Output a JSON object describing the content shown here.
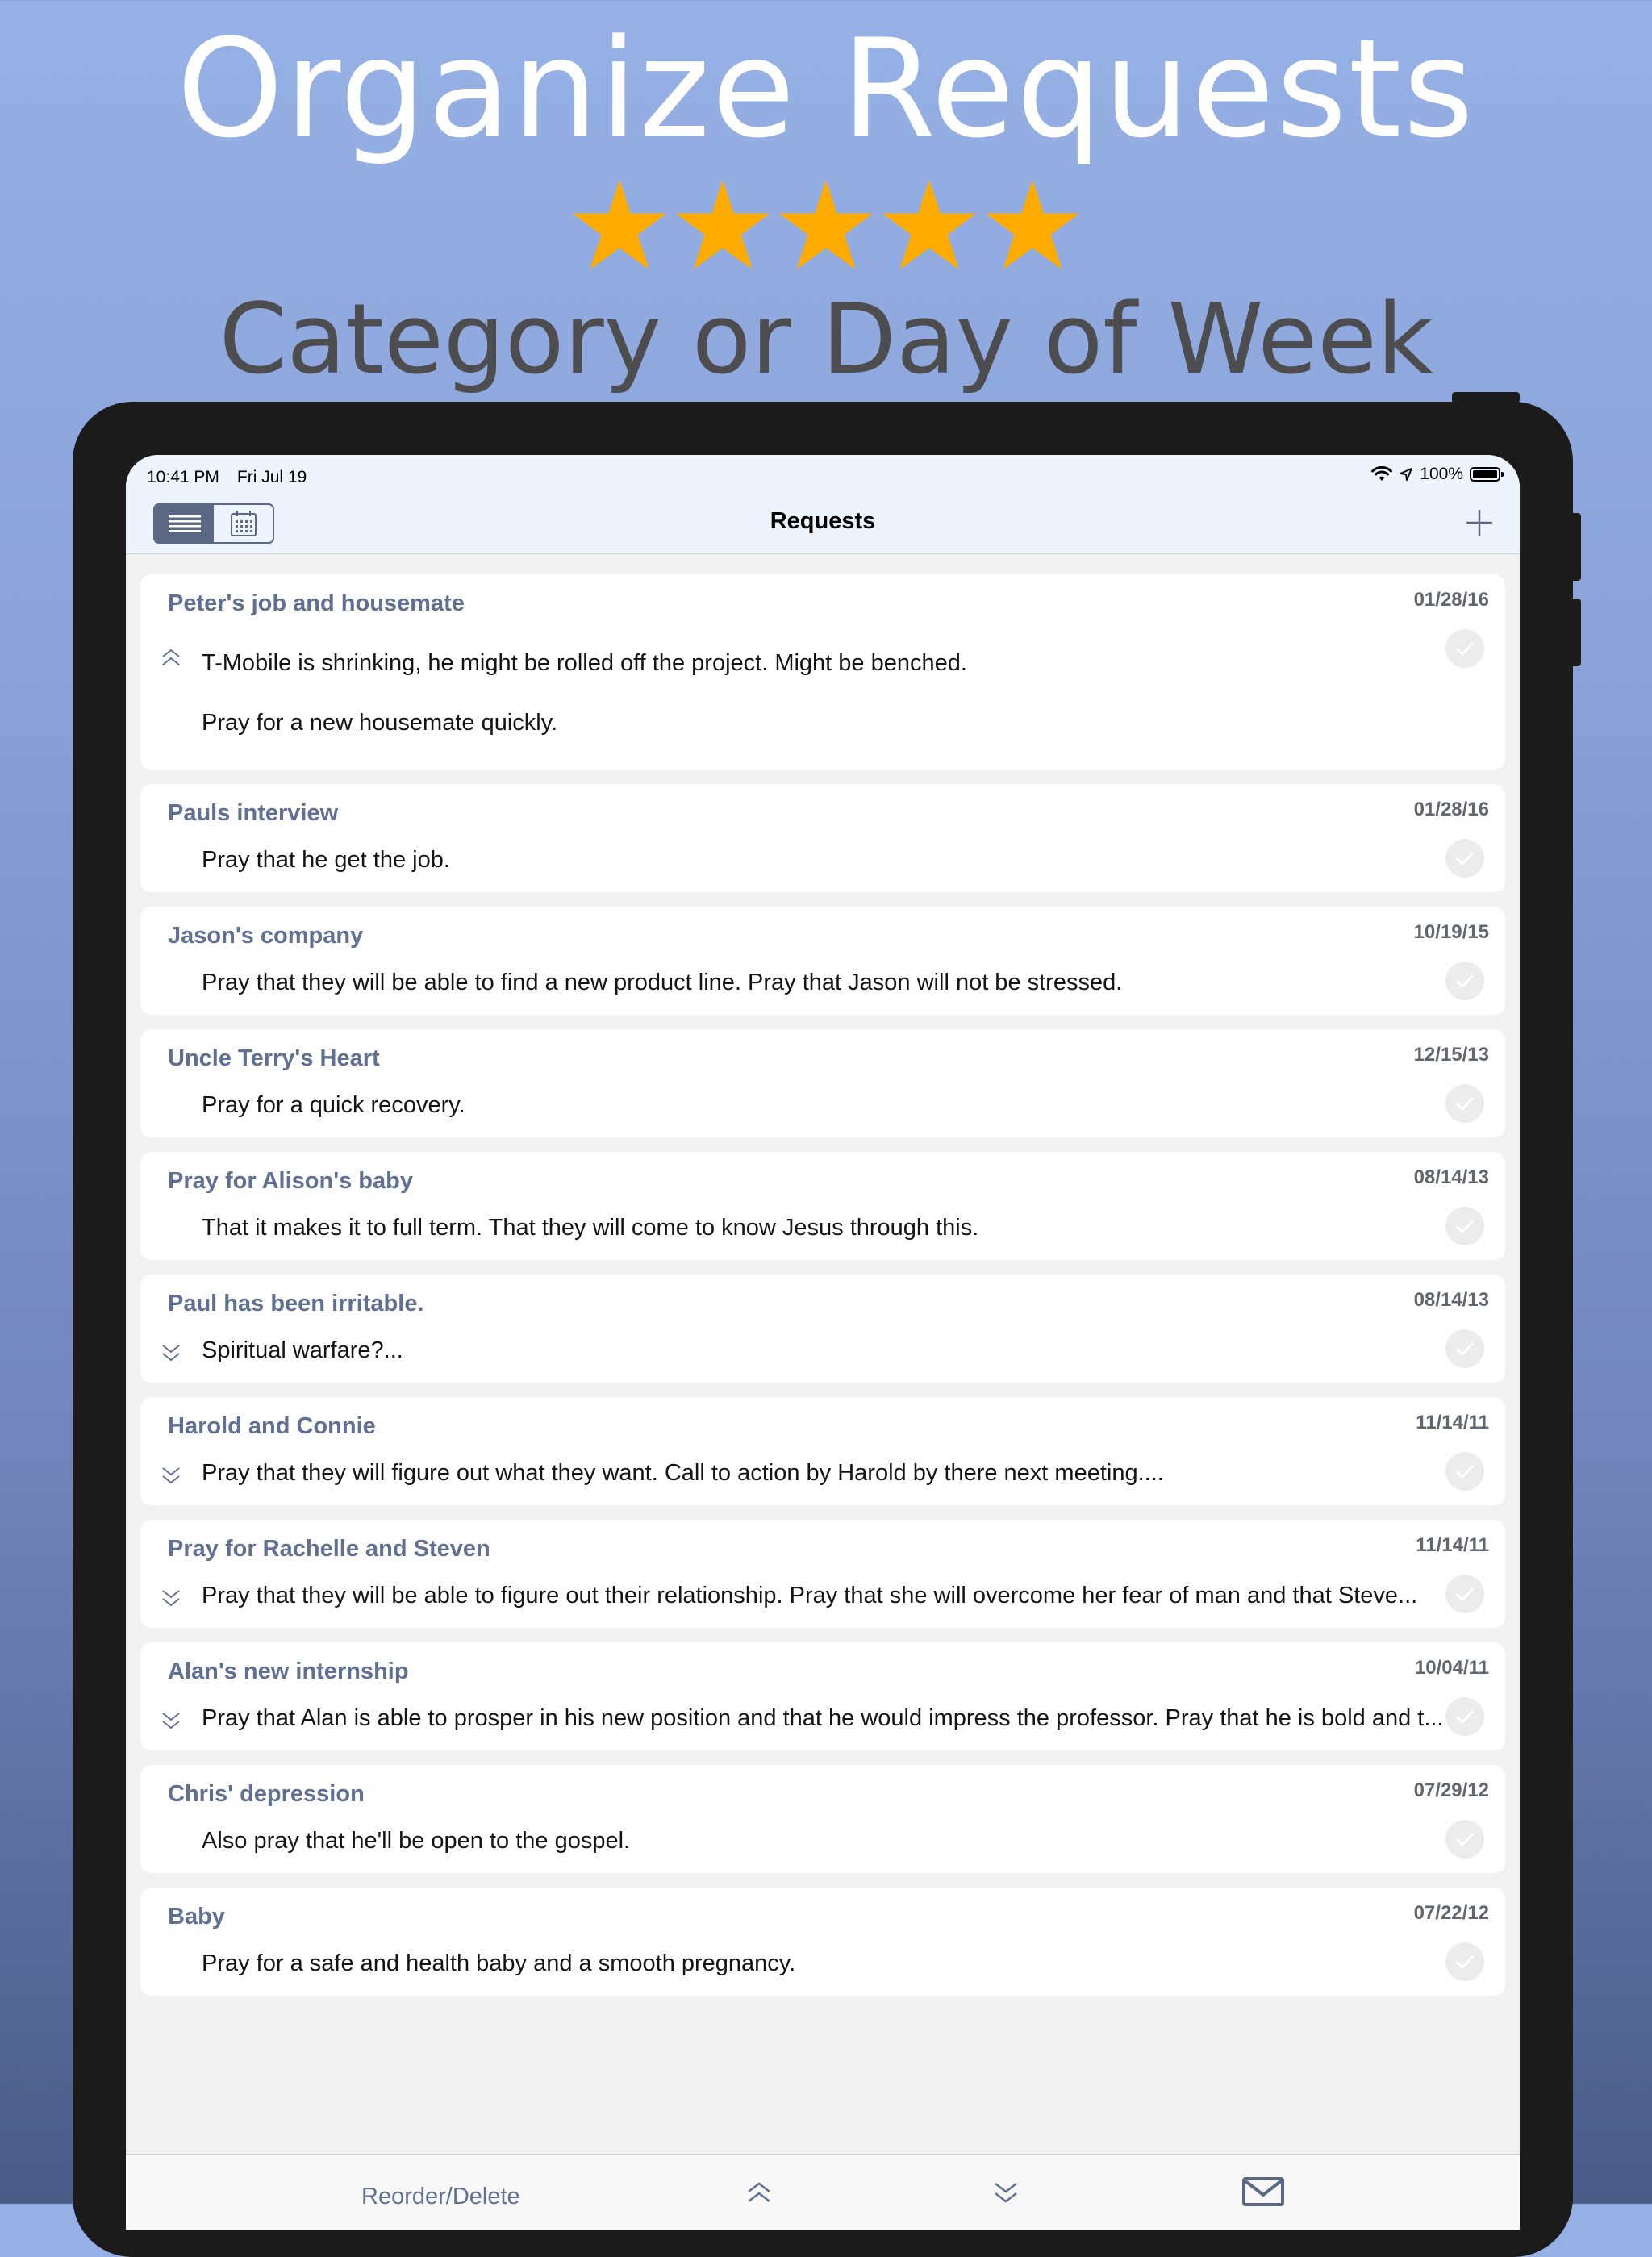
{
  "promo": {
    "headline": "Organize Requests",
    "subheadline": "Category or Day of Week",
    "rating": 5,
    "star_color": "#ffab00"
  },
  "status_bar": {
    "time": "10:41 PM",
    "date": "Fri Jul 19",
    "battery": "100%",
    "icons": [
      "wifi-icon",
      "location-arrow-icon",
      "battery-icon"
    ]
  },
  "nav": {
    "title": "Requests",
    "view_toggle": [
      "list-view-icon",
      "calendar-view-icon"
    ],
    "active_view": "list",
    "add_icon": "plus-icon"
  },
  "requests": [
    {
      "title": "Peter's job and housemate",
      "date": "01/28/16",
      "lines": [
        "T-Mobile is shrinking, he might be rolled off the project. Might be benched.",
        "Pray for a new housemate quickly."
      ],
      "expand": "collapse"
    },
    {
      "title": "Pauls interview",
      "date": "01/28/16",
      "lines": [
        "Pray that he get the job."
      ],
      "expand": "none"
    },
    {
      "title": "Jason's company",
      "date": "10/19/15",
      "lines": [
        "Pray that they will be able to find a new product line. Pray that Jason will not be stressed."
      ],
      "expand": "none"
    },
    {
      "title": "Uncle Terry's Heart",
      "date": "12/15/13",
      "lines": [
        "Pray for a quick recovery."
      ],
      "expand": "none"
    },
    {
      "title": "Pray for Alison's baby",
      "date": "08/14/13",
      "lines": [
        "That it makes it to full term. That they will come to know Jesus through this."
      ],
      "expand": "none"
    },
    {
      "title": "Paul has been irritable.",
      "date": "08/14/13",
      "lines": [
        "Spiritual warfare?..."
      ],
      "expand": "expand"
    },
    {
      "title": "Harold and Connie",
      "date": "11/14/11",
      "lines": [
        "Pray that they will figure out what they want.  Call to action by Harold by there next meeting...."
      ],
      "expand": "expand"
    },
    {
      "title": "Pray for Rachelle and Steven",
      "date": "11/14/11",
      "lines": [
        "Pray that they will be able to figure out their relationship.  Pray that she will overcome her fear of man and that Steve..."
      ],
      "expand": "expand"
    },
    {
      "title": "Alan's new internship",
      "date": "10/04/11",
      "lines": [
        "Pray that Alan is able to prosper in his new position and that he would impress the professor. Pray that he is bold and t..."
      ],
      "expand": "expand"
    },
    {
      "title": "Chris' depression",
      "date": "07/29/12",
      "lines": [
        "Also pray that he'll be open to the gospel."
      ],
      "expand": "none"
    },
    {
      "title": "Baby",
      "date": "07/22/12",
      "lines": [
        "Pray for a safe and health baby and a smooth pregnancy."
      ],
      "expand": "none"
    }
  ],
  "toolbar": {
    "reorder_label": "Reorder/Delete",
    "icons": [
      "collapse-all-icon",
      "expand-all-icon",
      "mail-icon"
    ]
  },
  "colors": {
    "accent": "#5b6883",
    "title_text": "#5f7092",
    "nav_background": "#eef4fe"
  }
}
